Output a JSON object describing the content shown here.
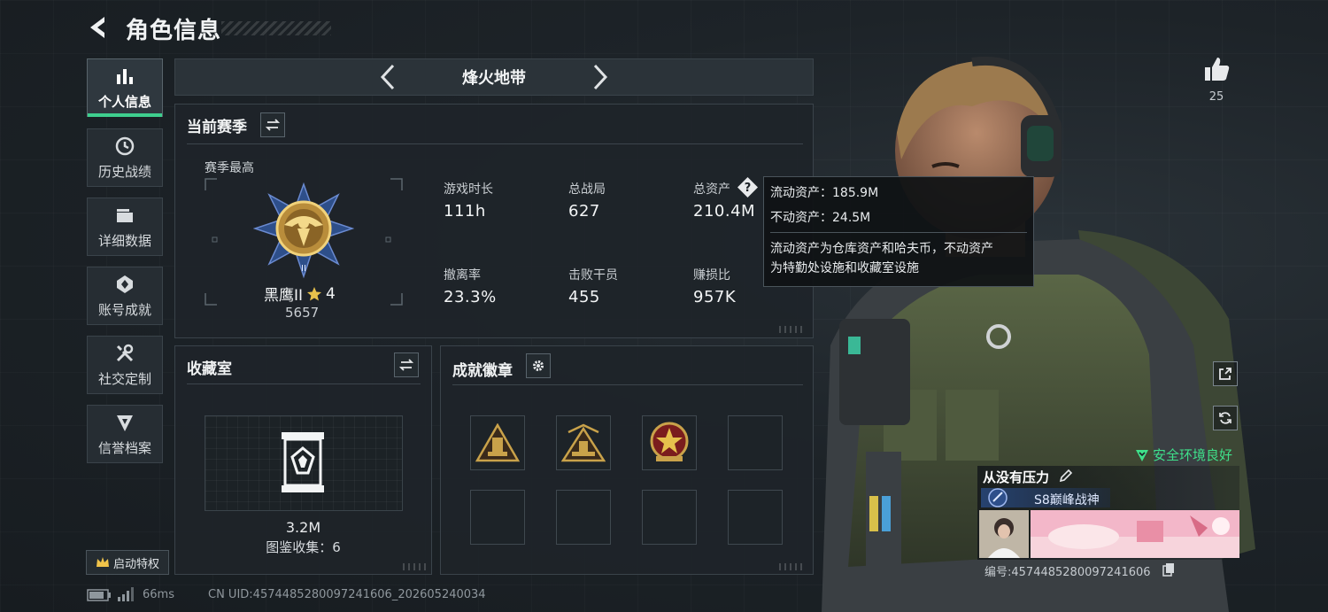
{
  "header": {
    "title": "角色信息"
  },
  "sidebar": {
    "items": [
      {
        "label": "个人信息",
        "icon": "bar-chart-icon",
        "active": true
      },
      {
        "label": "历史战绩",
        "icon": "history-icon"
      },
      {
        "label": "详细数据",
        "icon": "folder-icon"
      },
      {
        "label": "账号成就",
        "icon": "achievement-icon"
      },
      {
        "label": "社交定制",
        "icon": "tools-icon"
      },
      {
        "label": "信誉档案",
        "icon": "credit-icon"
      }
    ],
    "privilege": "启动特权"
  },
  "mode": {
    "title": "烽火地带"
  },
  "season": {
    "title": "当前赛季",
    "best_label": "赛季最高",
    "rank": "黑鹰II",
    "stars": "4",
    "score": "5657",
    "stats": [
      {
        "label": "游戏时长",
        "value": "111h"
      },
      {
        "label": "总战局",
        "value": "627"
      },
      {
        "label": "总资产",
        "value": "210.4M",
        "help": true
      },
      {
        "label": "撤离率",
        "value": "23.3%"
      },
      {
        "label": "击败干员",
        "value": "455"
      },
      {
        "label": "赚损比",
        "value": "957K"
      }
    ]
  },
  "tooltip": {
    "line1": "流动资产：185.9M",
    "line2": "不动资产：24.5M",
    "desc1": "流动资产为仓库资产和哈夫币，不动资产",
    "desc2": "为特勤处设施和收藏室设施"
  },
  "collection": {
    "title": "收藏室",
    "value": "3.2M",
    "count_text": "图鉴收集：6"
  },
  "badges": {
    "title": "成就徽章",
    "slots": [
      "badge-rank-1",
      "badge-rank-2",
      "badge-star",
      "",
      "",
      "",
      "",
      ""
    ]
  },
  "profile": {
    "likes": "25",
    "safety": "安全环境良好",
    "name": "从没有压力",
    "title": "S8巅峰战神",
    "uid": "编号:4574485280097241606"
  },
  "footer": {
    "ping": "66ms",
    "uid": "CN UID:4574485280097241606_202605240034"
  },
  "colors": {
    "accent": "#3ecf8e",
    "panel": "#1e2429",
    "gold": "#c9a24a"
  }
}
